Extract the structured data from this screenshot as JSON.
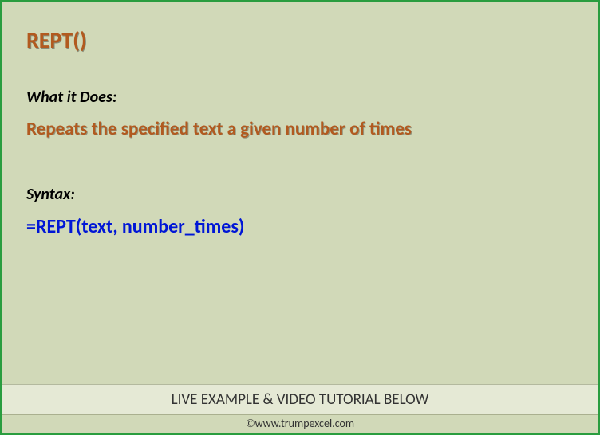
{
  "title": "REPT()",
  "sections": {
    "whatItDoes": {
      "label": "What it Does:",
      "text": "Repeats the specified text a given number of times"
    },
    "syntax": {
      "label": "Syntax:",
      "text": "=REPT(text, number_times)"
    }
  },
  "footer": {
    "cta": "LIVE EXAMPLE & VIDEO TUTORIAL BELOW",
    "credit": "©www.trumpexcel.com"
  }
}
